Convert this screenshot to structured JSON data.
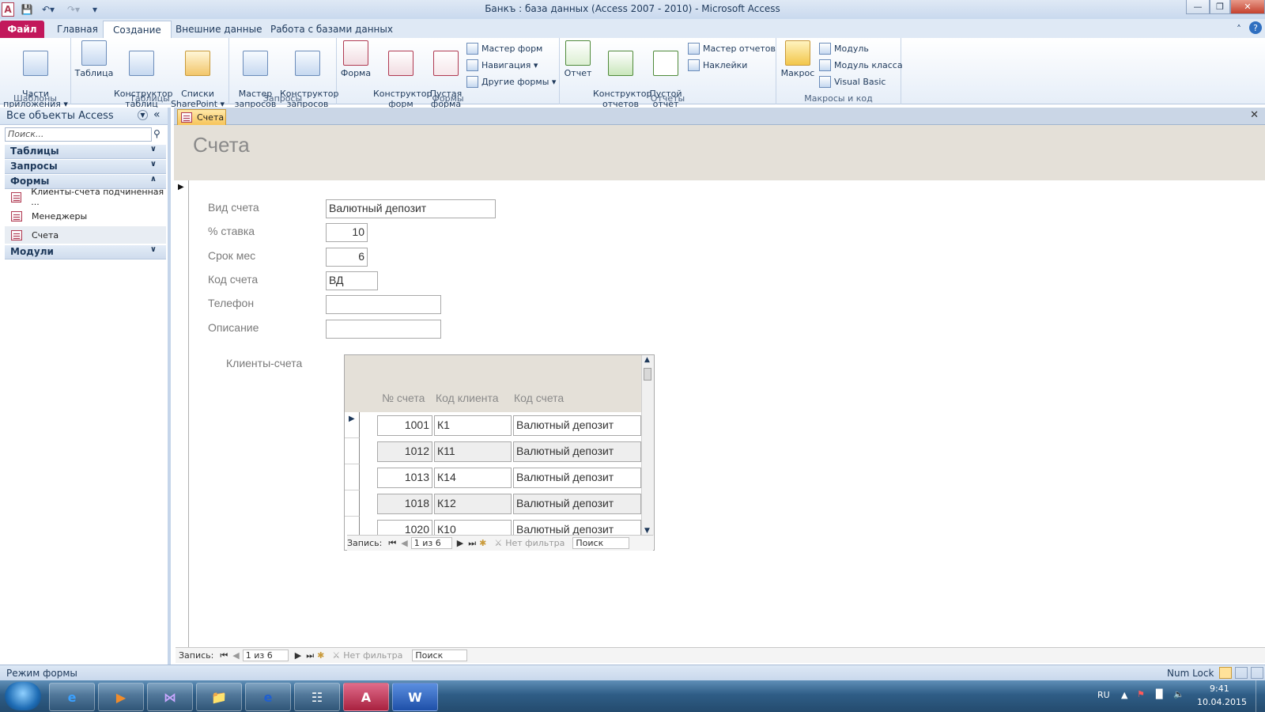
{
  "window": {
    "title": "Банкъ : база данных (Access 2007 - 2010)  -  Microsoft Access"
  },
  "ribbon_tabs": [
    "Файл",
    "Главная",
    "Создание",
    "Внешние данные",
    "Работа с базами данных"
  ],
  "ribbon": {
    "templates": {
      "label": "Шаблоны",
      "parts": "Части\nприложения ▾"
    },
    "tables": {
      "label": "Таблицы",
      "table": "Таблица",
      "designer": "Конструктор\nтаблиц",
      "sharepoint": "Списки\nSharePoint ▾"
    },
    "queries": {
      "label": "Запросы",
      "wizard": "Мастер\nзапросов",
      "designer": "Конструктор\nзапросов"
    },
    "forms": {
      "label": "Формы",
      "form": "Форма",
      "designer": "Конструктор\nформ",
      "blank": "Пустая\nформа",
      "wizard": "Мастер форм",
      "navigation": "Навигация ▾",
      "other": "Другие формы ▾"
    },
    "reports": {
      "label": "Отчеты",
      "report": "Отчет",
      "designer": "Конструктор\nотчетов",
      "blank": "Пустой\nотчет",
      "wizard": "Мастер отчетов",
      "labels": "Наклейки"
    },
    "macros": {
      "label": "Макросы и код",
      "macro": "Макрос",
      "module": "Модуль",
      "class_module": "Модуль класса",
      "vb": "Visual Basic"
    }
  },
  "nav": {
    "title": "Все объекты Access",
    "search_placeholder": "Поиск...",
    "sections": {
      "tables": "Таблицы",
      "queries": "Запросы",
      "forms": "Формы",
      "modules": "Модули"
    },
    "forms": [
      "Клиенты-счета подчиненная ...",
      "Менеджеры",
      "Счета"
    ]
  },
  "document": {
    "tab": "Счета",
    "title": "Счета",
    "fields": [
      {
        "label": "Вид счета",
        "value": "Валютный депозит"
      },
      {
        "label": "% ставка",
        "value": "10"
      },
      {
        "label": "Срок мес",
        "value": "6"
      },
      {
        "label": "Код счета",
        "value": "ВД"
      },
      {
        "label": "Телефон",
        "value": ""
      },
      {
        "label": "Описание",
        "value": ""
      }
    ],
    "subform": {
      "label": "Клиенты-счета",
      "columns": [
        "№ счета",
        "Код клиента",
        "Код счета"
      ],
      "rows": [
        [
          "1001",
          "К1",
          "Валютный депозит"
        ],
        [
          "1012",
          "К11",
          "Валютный депозит"
        ],
        [
          "1013",
          "К14",
          "Валютный депозит"
        ],
        [
          "1018",
          "К12",
          "Валютный депозит"
        ],
        [
          "1020",
          "К10",
          "Валютный депозит"
        ]
      ],
      "nav": {
        "label": "Запись:",
        "position": "1 из 6",
        "filter": "Нет фильтра",
        "search": "Поиск"
      }
    },
    "record_nav": {
      "label": "Запись:",
      "position": "1 из 6",
      "filter": "Нет фильтра",
      "search": "Поиск"
    }
  },
  "status": {
    "mode": "Режим формы",
    "numlock": "Num Lock"
  },
  "taskbar": {
    "lang": "RU",
    "time": "9:41",
    "date": "10.04.2015"
  },
  "colors": {
    "file_tab": "#c2185b",
    "doc_tab": "#f7c45a",
    "form_header": "#e4e0d8",
    "taskbar": "#2f5d86"
  }
}
